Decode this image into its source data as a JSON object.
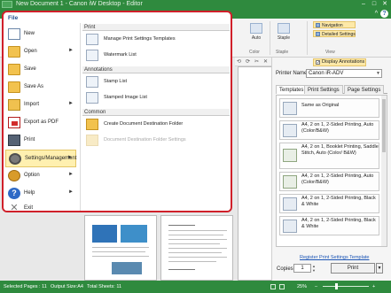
{
  "window": {
    "title": "New Document 1 - Canon iW Desktop - Editor",
    "minimize": "–",
    "maximize": "□",
    "close": "✕"
  },
  "ribbon": {
    "help_icon": "?",
    "collapse_icon": "^",
    "auto_label": "Auto",
    "staple_label": "Staple",
    "color_group": "Color",
    "staple_group": "Staple",
    "view_group": "View",
    "navigation_label": "Navigation",
    "detailed_settings_label": "Detailed Settings"
  },
  "file_menu": {
    "title": "File",
    "items": [
      {
        "label": "New",
        "icon": "new-document-icon",
        "arrow": ""
      },
      {
        "label": "Open",
        "icon": "folder-open-icon",
        "arrow": "►"
      },
      {
        "label": "Save",
        "icon": "save-icon",
        "arrow": ""
      },
      {
        "label": "Save As",
        "icon": "save-as-icon",
        "arrow": ""
      },
      {
        "label": "Import",
        "icon": "import-icon",
        "arrow": "►"
      },
      {
        "label": "Export as PDF",
        "icon": "pdf-icon",
        "arrow": ""
      },
      {
        "label": "Print",
        "icon": "printer-icon",
        "arrow": ""
      },
      {
        "label": "Settings/Management",
        "icon": "gear-icon",
        "arrow": "►"
      },
      {
        "label": "Option",
        "icon": "option-icon",
        "arrow": "►"
      },
      {
        "label": "Help",
        "icon": "help-icon",
        "arrow": "►"
      },
      {
        "label": "Exit",
        "icon": "exit-icon",
        "arrow": ""
      }
    ],
    "sections": {
      "print_header": "Print",
      "manage_print_settings": "Manage Print Settings Templates",
      "watermark_list": "Watermark List",
      "annotations_header": "Annotations",
      "stamp_list": "Stamp List",
      "stamped_image_list": "Stamped Image List",
      "common_header": "Common",
      "create_destination_folder": "Create Document Destination Folder",
      "destination_folder_settings": "Document Destination Folder Settings"
    }
  },
  "right_panel": {
    "display_annotations": "Display Annotations",
    "display_annotations_check": "✓",
    "printer_name_label": "Printer Name:",
    "printer_name_value": "Canon iR-ADV",
    "tabs": [
      "Templates",
      "Print Settings",
      "Page Settings"
    ],
    "templates": [
      "Same as Original",
      "A4, 2 on 1, 2-Sided Printing, Auto (Color/B&W)",
      "A4, 2 on 1, Booklet Printing, Saddle Stitch, Auto (Color/ B&W)",
      "A4, 2 on 1, 2-Sided Printing, Auto (Color/B&W)",
      "A4, 2 on 1, 2-Sided Printing, Black & White",
      "A4, 2 on 1, 2-Sided Printing, Black & White"
    ],
    "register_link": "Register Print Settings Template",
    "copies_label": "Copies:",
    "copies_value": "1",
    "print_button": "Print",
    "print_dropdown": "▼"
  },
  "status": {
    "selected_pages": "Selected Pages : 11",
    "output_size": "Output Size:A4",
    "total_sheets": "Total Sheets: 11",
    "zoom": "25%",
    "zoom_minus": "–",
    "zoom_plus": "+"
  }
}
